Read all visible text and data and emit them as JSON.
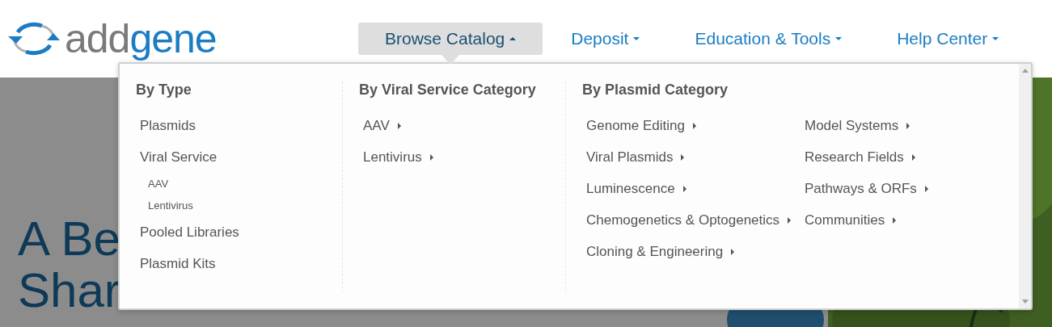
{
  "logo": {
    "part1": "add",
    "part2": "gene"
  },
  "nav": [
    {
      "label": "Browse Catalog",
      "selected": true,
      "expanded": true
    },
    {
      "label": "Deposit",
      "selected": false,
      "expanded": false
    },
    {
      "label": "Education & Tools",
      "selected": false,
      "expanded": false
    },
    {
      "label": "Help Center",
      "selected": false,
      "expanded": false
    }
  ],
  "hero": {
    "lines": [
      "A Be",
      "Shar"
    ],
    "kind": "picture"
  },
  "menu": {
    "sections": [
      {
        "heading": "By Type",
        "columns": [
          [
            {
              "label": "Plasmids",
              "submenu": false
            },
            {
              "label": "Viral Service",
              "submenu": false,
              "children": [
                {
                  "label": "AAV",
                  "submenu": false
                },
                {
                  "label": "Lentivirus",
                  "submenu": false
                }
              ]
            },
            {
              "label": "Pooled Libraries",
              "submenu": false
            },
            {
              "label": "Plasmid Kits",
              "submenu": false
            }
          ]
        ]
      },
      {
        "heading": "By Viral Service Category",
        "columns": [
          [
            {
              "label": "AAV",
              "submenu": true
            },
            {
              "label": "Lentivirus",
              "submenu": true
            }
          ]
        ]
      },
      {
        "heading": "By Plasmid Category",
        "columns": [
          [
            {
              "label": "Genome Editing",
              "submenu": true
            },
            {
              "label": "Viral Plasmids",
              "submenu": true
            },
            {
              "label": "Luminescence",
              "submenu": true
            },
            {
              "label": "Chemogenetics & Optogenetics",
              "submenu": true
            },
            {
              "label": "Cloning & Engineering",
              "submenu": true
            }
          ],
          [
            {
              "label": "Model Systems",
              "submenu": true
            },
            {
              "label": "Research Fields",
              "submenu": true
            },
            {
              "label": "Pathways & ORFs",
              "submenu": true
            },
            {
              "label": "Communities",
              "submenu": true
            }
          ]
        ]
      }
    ]
  }
}
